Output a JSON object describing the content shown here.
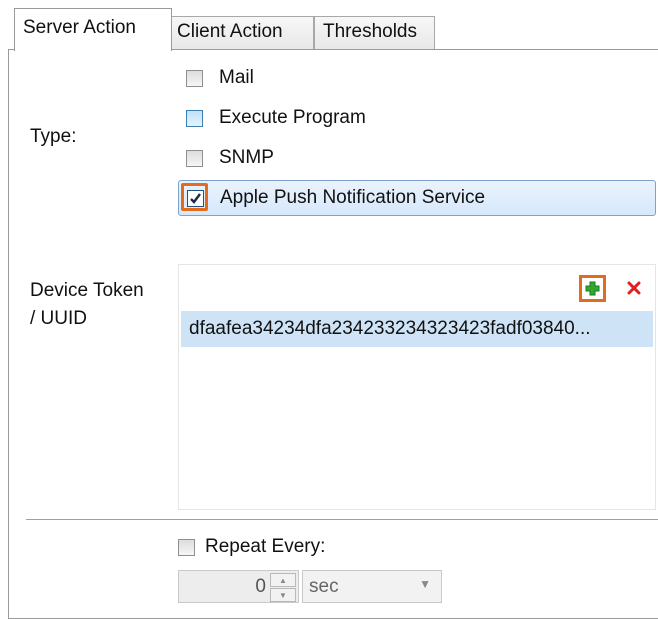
{
  "tabs": [
    {
      "label": "Server Action",
      "active": true
    },
    {
      "label": "Client Action",
      "active": false
    },
    {
      "label": "Thresholds",
      "active": false
    }
  ],
  "type_section": {
    "label": "Type:",
    "options": [
      {
        "label": "Mail",
        "checked": false
      },
      {
        "label": "Execute Program",
        "checked": false
      },
      {
        "label": "SNMP",
        "checked": false
      },
      {
        "label": "Apple Push Notification Service",
        "checked": true
      }
    ]
  },
  "device_token": {
    "label_line1": "Device Token",
    "label_line2": "/ UUID",
    "add_icon": "add-plus-icon",
    "delete_icon": "delete-x-icon",
    "tokens": [
      "dfaafea34234dfa234233234323423fadf03840..."
    ]
  },
  "repeat": {
    "label": "Repeat Every:",
    "checked": false,
    "value": "0",
    "unit": "sec"
  },
  "colors": {
    "focus": "#e36c1c",
    "selection": "#cfe3f7",
    "add_green": "#2ea82e",
    "delete_red": "#e02020"
  }
}
